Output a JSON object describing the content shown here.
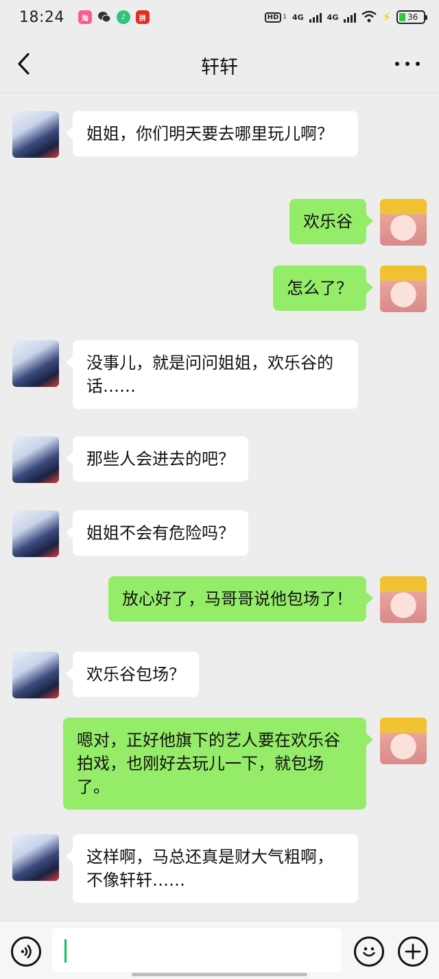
{
  "status_bar": {
    "time": "18:24",
    "hd": "HD",
    "hd_sub": "1",
    "network_1": "4G",
    "network_2": "4G",
    "battery": "36",
    "app_icons": [
      "taobao-icon",
      "wechat-icon",
      "qq-music-icon",
      "pinduoduo-icon"
    ]
  },
  "header": {
    "title": "轩轩"
  },
  "messages": [
    {
      "side": "left",
      "text": "姐姐，你们明天要去哪里玩儿啊？"
    },
    {
      "side": "right",
      "text": "欢乐谷"
    },
    {
      "side": "right",
      "text": "怎么了？"
    },
    {
      "side": "left",
      "text": "没事儿，就是问问姐姐，欢乐谷的话……"
    },
    {
      "side": "left",
      "text": "那些人会进去的吧？"
    },
    {
      "side": "left",
      "text": "姐姐不会有危险吗？"
    },
    {
      "side": "right",
      "text": "放心好了，马哥哥说他包场了！"
    },
    {
      "side": "left",
      "text": "欢乐谷包场？"
    },
    {
      "side": "right",
      "text": "嗯对，正好他旗下的艺人要在欢乐谷拍戏，也刚好去玩儿一下，就包场了。"
    },
    {
      "side": "left",
      "text": "这样啊，马总还真是财大气粗啊，不像轩轩……"
    }
  ],
  "input_bar": {
    "value": "",
    "icons": [
      "voice-icon",
      "emoji-icon",
      "plus-icon"
    ]
  },
  "colors": {
    "background": "#ededed",
    "outgoing_bubble": "#95ec69",
    "incoming_bubble": "#ffffff",
    "caret": "#07c160"
  }
}
